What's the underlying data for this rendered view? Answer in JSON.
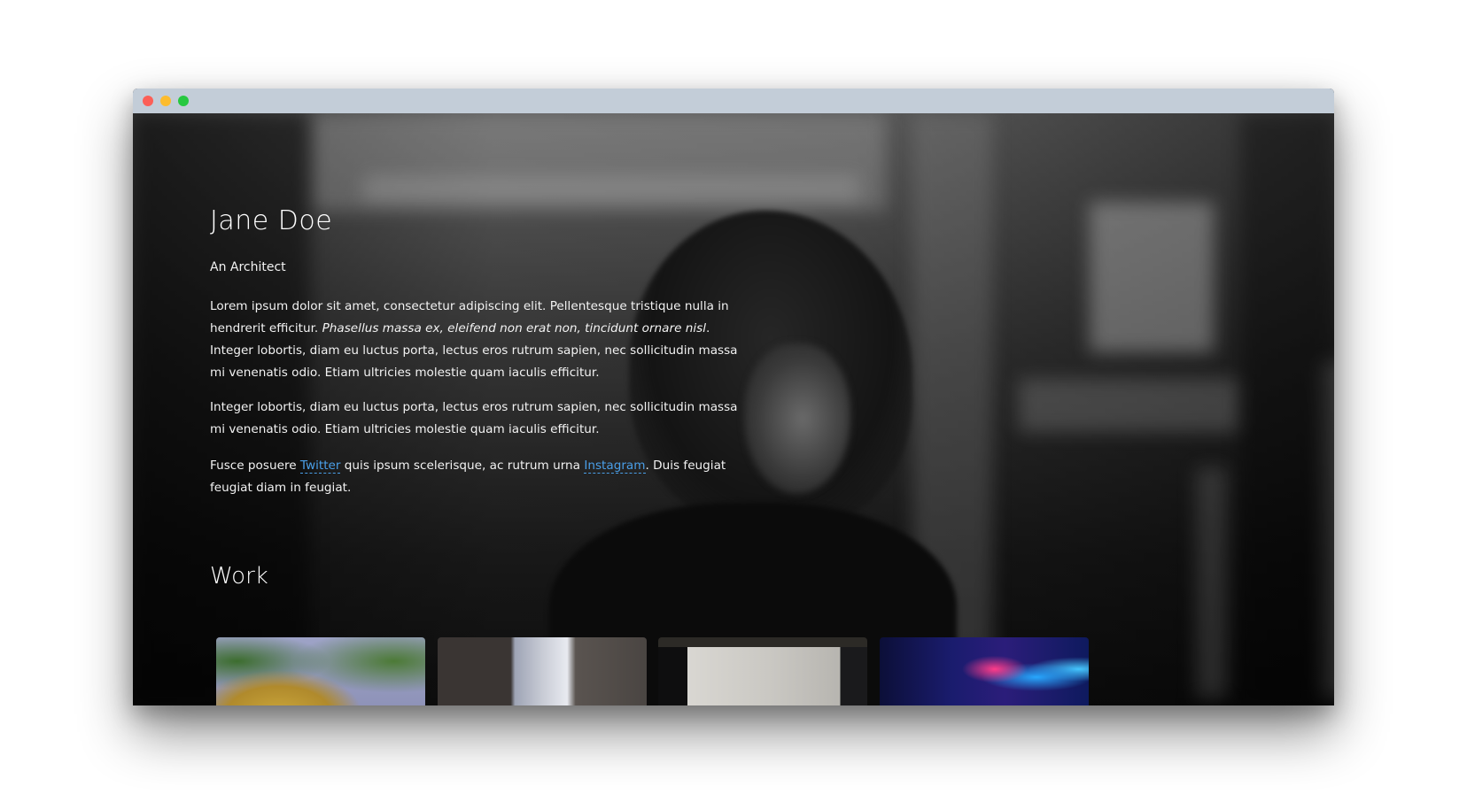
{
  "window": {
    "controls": [
      "close",
      "minimize",
      "maximize"
    ]
  },
  "profile": {
    "name": "Jane Doe",
    "subtitle": "An Architect"
  },
  "about": {
    "p1_start": "Lorem ipsum dolor sit amet, consectetur adipiscing elit. Pellentesque tristique nulla in hendrerit efficitur. ",
    "p1_italic": "Phasellus massa ex, eleifend non erat non, tincidunt ornare nisl",
    "p1_end": ". Integer lobortis, diam eu luctus porta, lectus eros rutrum sapien, nec sollicitudin massa mi venenatis odio. Etiam ultricies molestie quam iaculis efficitur.",
    "p2": "Integer lobortis, diam eu luctus porta, lectus eros rutrum sapien, nec sollicitudin massa mi venenatis odio. Etiam ultricies molestie quam iaculis efficitur.",
    "p3_start": "Fusce posuere ",
    "p3_link1": "Twitter",
    "p3_mid": " quis ipsum scelerisque, ac rutrum urna ",
    "p3_link2": "Instagram",
    "p3_end": ". Duis feugiat feugiat diam in feugiat."
  },
  "work": {
    "title": "Work",
    "items": [
      {
        "subject": "dome-building-trees"
      },
      {
        "subject": "highrise-apartments"
      },
      {
        "subject": "concrete-building"
      },
      {
        "subject": "neon-city-night"
      }
    ]
  },
  "colors": {
    "link": "#4a9fe8",
    "titlebar": "#c3cdd8",
    "close": "#fc5f57",
    "minimize": "#fdbc2e",
    "maximize": "#27c840"
  }
}
